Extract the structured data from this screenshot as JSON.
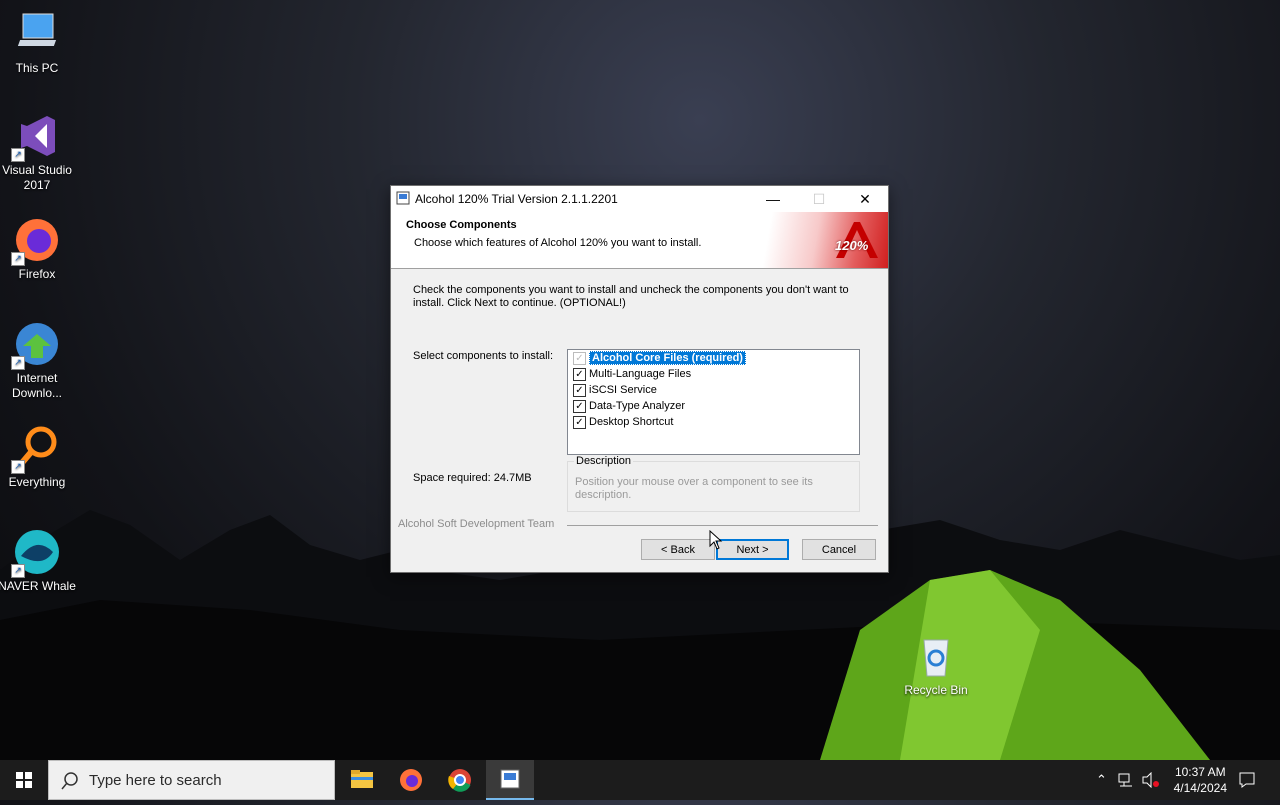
{
  "desktop": {
    "icons": [
      {
        "label": "This PC"
      },
      {
        "label": "Visual Studio 2017"
      },
      {
        "label": "Firefox"
      },
      {
        "label": "Internet Downlo..."
      },
      {
        "label": "Everything"
      },
      {
        "label": "NAVER Whale"
      },
      {
        "label": "Recycle Bin"
      }
    ]
  },
  "dialog": {
    "title": "Alcohol 120% Trial Version 2.1.1.2201",
    "header_title": "Choose Components",
    "header_subtitle": "Choose which features of Alcohol 120% you want to install.",
    "banner_logo": "120%",
    "instructions": "Check the components you want to install and uncheck the components you don't want to install. Click Next to continue. (OPTIONAL!)",
    "select_label": "Select components to install:",
    "components": [
      {
        "label": "Alcohol Core Files (required)",
        "checked": true,
        "disabled": true,
        "selected": true
      },
      {
        "label": "Multi-Language Files",
        "checked": true
      },
      {
        "label": "iSCSI Service",
        "checked": true
      },
      {
        "label": "Data-Type Analyzer",
        "checked": true
      },
      {
        "label": "Desktop Shortcut",
        "checked": true
      }
    ],
    "space_required": "Space required: 24.7MB",
    "description_legend": "Description",
    "description_text": "Position your mouse over a component to see its description.",
    "branding": "Alcohol Soft Development Team",
    "buttons": {
      "back": "< Back",
      "next": "Next >",
      "cancel": "Cancel"
    }
  },
  "taskbar": {
    "search_placeholder": "Type here to search",
    "time": "10:37 AM",
    "date": "4/14/2024"
  }
}
